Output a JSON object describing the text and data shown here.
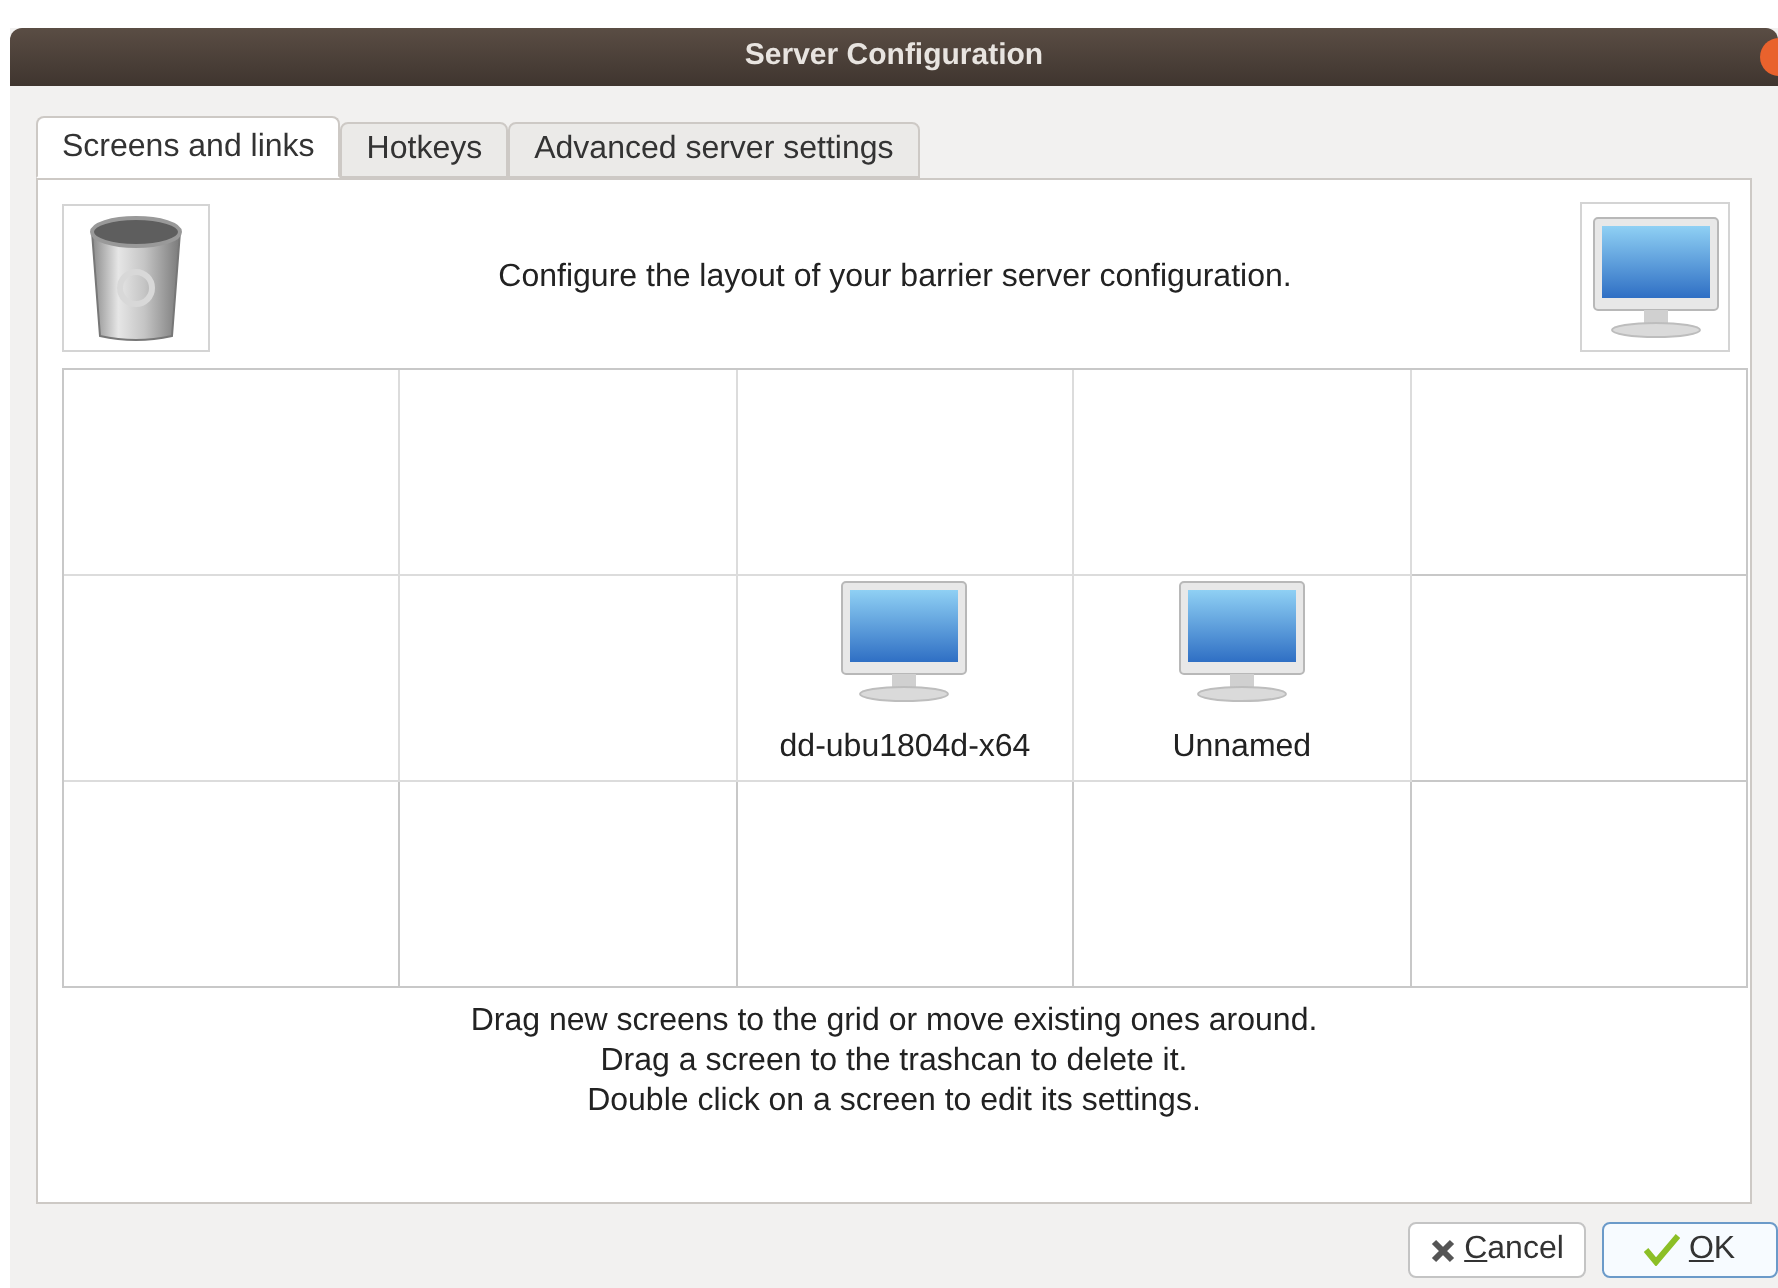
{
  "window": {
    "title": "Server Configuration"
  },
  "tabs": [
    {
      "label": "Screens and links",
      "selected": true
    },
    {
      "label": "Hotkeys",
      "selected": false
    },
    {
      "label": "Advanced server settings",
      "selected": false
    }
  ],
  "header": {
    "text": "Configure the layout of your barrier server configuration."
  },
  "grid": {
    "rows": [
      [
        null,
        null,
        null,
        null,
        null
      ],
      [
        null,
        null,
        {
          "name": "dd-ubu1804d-x64"
        },
        {
          "name": "Unnamed"
        },
        null
      ],
      [
        null,
        null,
        null,
        null,
        null
      ]
    ]
  },
  "instructions": [
    "Drag new screens to the grid or move existing ones around.",
    "Drag a screen to the trashcan to delete it.",
    "Double click on a screen to edit its settings."
  ],
  "buttons": [
    {
      "kind": "cancel",
      "label": "Cancel"
    },
    {
      "kind": "ok",
      "label": "OK"
    }
  ]
}
